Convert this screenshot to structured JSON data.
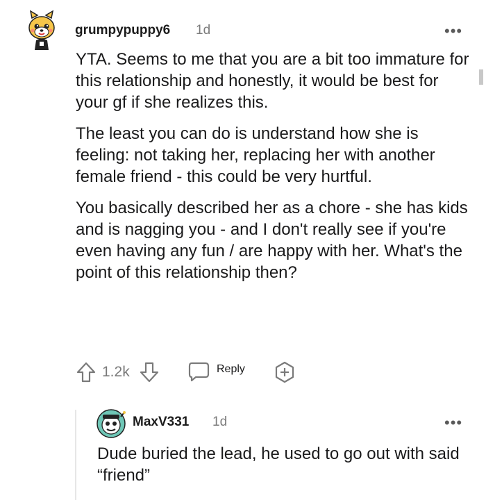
{
  "comment": {
    "username": "grumpypuppy6",
    "time": "1d",
    "more": "•••",
    "paragraphs": [
      "YTA. Seems to me that you are a bit too immature for this relationship and honestly, it would be best for your gf if she realizes this.",
      "The least you can do is understand how she is feeling: not taking her, replacing her with another female friend - this could be very hurtful.",
      "You basically described her as a chore - she has kids and is nagging you - and I don't really see if you're even having any fun / are happy with her. What's the point of this relationship then?"
    ],
    "votes": "1.2k",
    "reply_label": "Reply"
  },
  "reply": {
    "username": "MaxV331",
    "time": "1d",
    "more": "•••",
    "text": "Dude buried the lead, he used to go out with said “friend”"
  }
}
